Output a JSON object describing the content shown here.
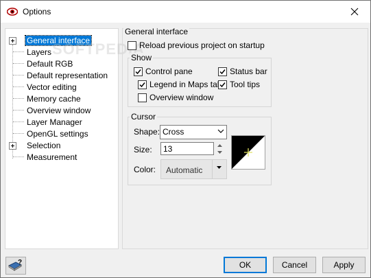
{
  "window": {
    "title": "Options"
  },
  "watermark": "SOFTPEDIA",
  "tree": {
    "items": [
      {
        "label": "General interface",
        "expandable": true,
        "selected": true
      },
      {
        "label": "Layers"
      },
      {
        "label": "Default RGB"
      },
      {
        "label": "Default representation"
      },
      {
        "label": "Vector editing"
      },
      {
        "label": "Memory cache"
      },
      {
        "label": "Overview window"
      },
      {
        "label": "Layer Manager"
      },
      {
        "label": "OpenGL settings"
      },
      {
        "label": "Selection",
        "expandable": true
      },
      {
        "label": "Measurement"
      }
    ]
  },
  "general": {
    "title": "General interface",
    "reload": {
      "label": "Reload previous project on startup",
      "checked": false
    }
  },
  "show": {
    "title": "Show",
    "control_pane": {
      "label": "Control pane",
      "checked": true
    },
    "status_bar": {
      "label": "Status bar",
      "checked": true
    },
    "legend_maps": {
      "label": "Legend in Maps tab",
      "checked": true
    },
    "tool_tips": {
      "label": "Tool tips",
      "checked": true
    },
    "overview_window": {
      "label": "Overview window",
      "checked": false
    }
  },
  "cursor": {
    "title": "Cursor",
    "shape_label": "Shape:",
    "shape_value": "Cross",
    "size_label": "Size:",
    "size_value": "13",
    "color_label": "Color:",
    "color_value": "Automatic"
  },
  "buttons": {
    "ok": "OK",
    "cancel": "Cancel",
    "apply": "Apply"
  },
  "colors": {
    "selection": "#0078d7",
    "background": "#f0f0f0"
  }
}
